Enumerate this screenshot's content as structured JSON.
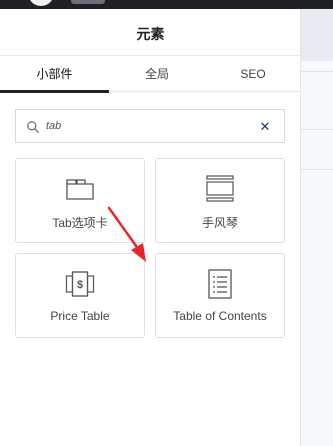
{
  "panel": {
    "title": "元素",
    "tabs": [
      {
        "label": "小部件",
        "active": true
      },
      {
        "label": "全局",
        "active": false
      },
      {
        "label": "SEO",
        "active": false
      }
    ]
  },
  "search": {
    "value": "tab",
    "clear_icon": "close-icon",
    "search_icon": "search-icon"
  },
  "widgets": [
    {
      "label": "Tab选项卡",
      "icon": "tabs-icon"
    },
    {
      "label": "手风琴",
      "icon": "accordion-icon"
    },
    {
      "label": "Price Table",
      "icon": "price-table-icon"
    },
    {
      "label": "Table of Contents",
      "icon": "table-of-contents-icon"
    }
  ],
  "colors": {
    "topbar": "#1f2124",
    "accent_underline": "#222222",
    "clear_x": "#1e3a5f",
    "annotation_arrow": "#e8262a"
  }
}
